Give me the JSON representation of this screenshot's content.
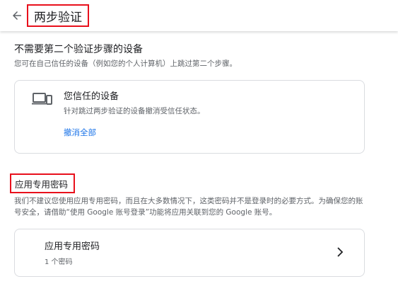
{
  "header": {
    "back_icon": "arrow-back-icon",
    "title": "两步验证"
  },
  "skip_section": {
    "title": "不需要第二个验证步骤的设备",
    "description": "您可在自己信任的设备（例如您的个人计算机）上跳过第二个步骤。"
  },
  "trusted_card": {
    "icon": "devices-icon",
    "title": "您信任的设备",
    "description": "针对跳过两步验证的设备撤消受信任状态。",
    "revoke_link": "撤消全部"
  },
  "app_passwords_section": {
    "title": "应用专用密码",
    "description": "我们不建议您使用应用专用密码，而且在大多数情况下，这类密码并不是登录时的必要方式。为确保您的账号安全，请借助“使用 Google 账号登录”功能将应用关联到您的 Google 账号。"
  },
  "app_passwords_card": {
    "title": "应用专用密码",
    "count": "1 个密码",
    "chevron_icon": "chevron-right-icon"
  },
  "colors": {
    "highlight": "#e8101c",
    "link": "#1a73e8",
    "secondary_text": "#5f6368"
  }
}
